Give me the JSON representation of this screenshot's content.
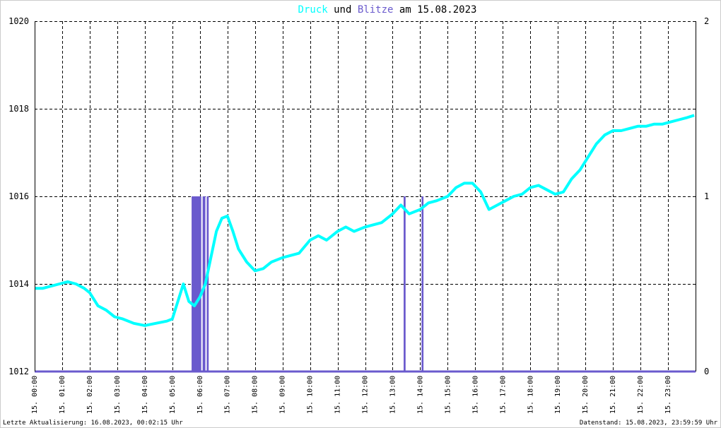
{
  "title": {
    "part1": "Druck",
    "part2": " und ",
    "part3": "Blitze",
    "part4": " am 15.08.2023",
    "color_druck": "#00ffff",
    "color_blitze": "#6a5acd",
    "color_text": "#000000"
  },
  "footer": {
    "left": "Letzte Aktualisierung: 16.08.2023, 00:02:15 Uhr",
    "right": "Datenstand: 15.08.2023, 23:59:59 Uhr"
  },
  "chart_data": {
    "type": "line",
    "grid": true,
    "x_unit": "hours",
    "xlim": [
      0,
      24
    ],
    "x_ticks": [
      {
        "x": 0,
        "label": "15. 00:00"
      },
      {
        "x": 1,
        "label": "15. 01:00"
      },
      {
        "x": 2,
        "label": "15. 02:00"
      },
      {
        "x": 3,
        "label": "15. 03:00"
      },
      {
        "x": 4,
        "label": "15. 04:00"
      },
      {
        "x": 5,
        "label": "15. 05:00"
      },
      {
        "x": 6,
        "label": "15. 06:00"
      },
      {
        "x": 7,
        "label": "15. 07:00"
      },
      {
        "x": 8,
        "label": "15. 08:00"
      },
      {
        "x": 9,
        "label": "15. 09:00"
      },
      {
        "x": 10,
        "label": "15. 10:00"
      },
      {
        "x": 11,
        "label": "15. 11:00"
      },
      {
        "x": 12,
        "label": "15. 12:00"
      },
      {
        "x": 13,
        "label": "15. 13:00"
      },
      {
        "x": 14,
        "label": "15. 14:00"
      },
      {
        "x": 15,
        "label": "15. 15:00"
      },
      {
        "x": 16,
        "label": "15. 16:00"
      },
      {
        "x": 17,
        "label": "15. 17:00"
      },
      {
        "x": 18,
        "label": "15. 18:00"
      },
      {
        "x": 19,
        "label": "15. 19:00"
      },
      {
        "x": 20,
        "label": "15. 20:00"
      },
      {
        "x": 21,
        "label": "15. 21:00"
      },
      {
        "x": 22,
        "label": "15. 22:00"
      },
      {
        "x": 23,
        "label": "15. 23:00"
      }
    ],
    "y_left": {
      "ylim": [
        1012,
        1020
      ],
      "ticks": [
        "1012",
        "1014",
        "1016",
        "1018",
        "1020"
      ]
    },
    "y_right": {
      "ylim": [
        0,
        2
      ],
      "ticks": [
        "0",
        "1",
        "2"
      ]
    },
    "series": [
      {
        "color": "#00ffff",
        "axis": "left",
        "x": [
          0,
          0.3,
          0.6,
          0.9,
          1.2,
          1.5,
          1.8,
          2.0,
          2.3,
          2.6,
          2.9,
          3.2,
          3.6,
          4.0,
          4.4,
          4.8,
          5.0,
          5.2,
          5.4,
          5.6,
          5.8,
          6.0,
          6.2,
          6.4,
          6.6,
          6.8,
          7.0,
          7.2,
          7.4,
          7.7,
          8.0,
          8.3,
          8.6,
          9.0,
          9.3,
          9.6,
          10.0,
          10.3,
          10.6,
          11.0,
          11.3,
          11.6,
          12.0,
          12.3,
          12.6,
          13.0,
          13.3,
          13.6,
          14.0,
          14.3,
          14.6,
          15.0,
          15.3,
          15.6,
          15.9,
          16.2,
          16.5,
          16.8,
          17.1,
          17.4,
          17.7,
          18.0,
          18.3,
          18.6,
          18.9,
          19.2,
          19.5,
          19.8,
          20.1,
          20.4,
          20.7,
          21.0,
          21.3,
          21.6,
          21.9,
          22.2,
          22.5,
          22.8,
          23.1,
          23.4,
          23.7,
          23.95
        ],
        "y": [
          1013.9,
          1013.9,
          1013.95,
          1014.0,
          1014.05,
          1014.0,
          1013.9,
          1013.8,
          1013.5,
          1013.4,
          1013.25,
          1013.2,
          1013.1,
          1013.05,
          1013.1,
          1013.15,
          1013.2,
          1013.6,
          1014.0,
          1013.6,
          1013.5,
          1013.7,
          1014.0,
          1014.6,
          1015.2,
          1015.5,
          1015.55,
          1015.2,
          1014.8,
          1014.5,
          1014.3,
          1014.35,
          1014.5,
          1014.6,
          1014.65,
          1014.7,
          1015.0,
          1015.1,
          1015.0,
          1015.2,
          1015.3,
          1015.2,
          1015.3,
          1015.35,
          1015.4,
          1015.6,
          1015.8,
          1015.6,
          1015.7,
          1015.85,
          1015.9,
          1016.0,
          1016.2,
          1016.3,
          1016.3,
          1016.1,
          1015.7,
          1015.8,
          1015.9,
          1016.0,
          1016.05,
          1016.2,
          1016.25,
          1016.15,
          1016.05,
          1016.1,
          1016.4,
          1016.6,
          1016.9,
          1017.2,
          1017.4,
          1017.5,
          1017.5,
          1017.55,
          1017.6,
          1017.6,
          1017.65,
          1017.65,
          1017.7,
          1017.75,
          1017.8,
          1017.85
        ]
      },
      {
        "color": "#6a5acd",
        "axis": "right",
        "type": "bar",
        "bars": [
          {
            "x0": 5.7,
            "x1": 6.05,
            "value": 1
          },
          {
            "x0": 6.1,
            "x1": 6.2,
            "value": 1
          },
          {
            "x0": 6.25,
            "x1": 6.32,
            "value": 1
          },
          {
            "x0": 13.4,
            "x1": 13.47,
            "value": 1
          },
          {
            "x0": 14.05,
            "x1": 14.12,
            "value": 1
          }
        ]
      }
    ]
  }
}
